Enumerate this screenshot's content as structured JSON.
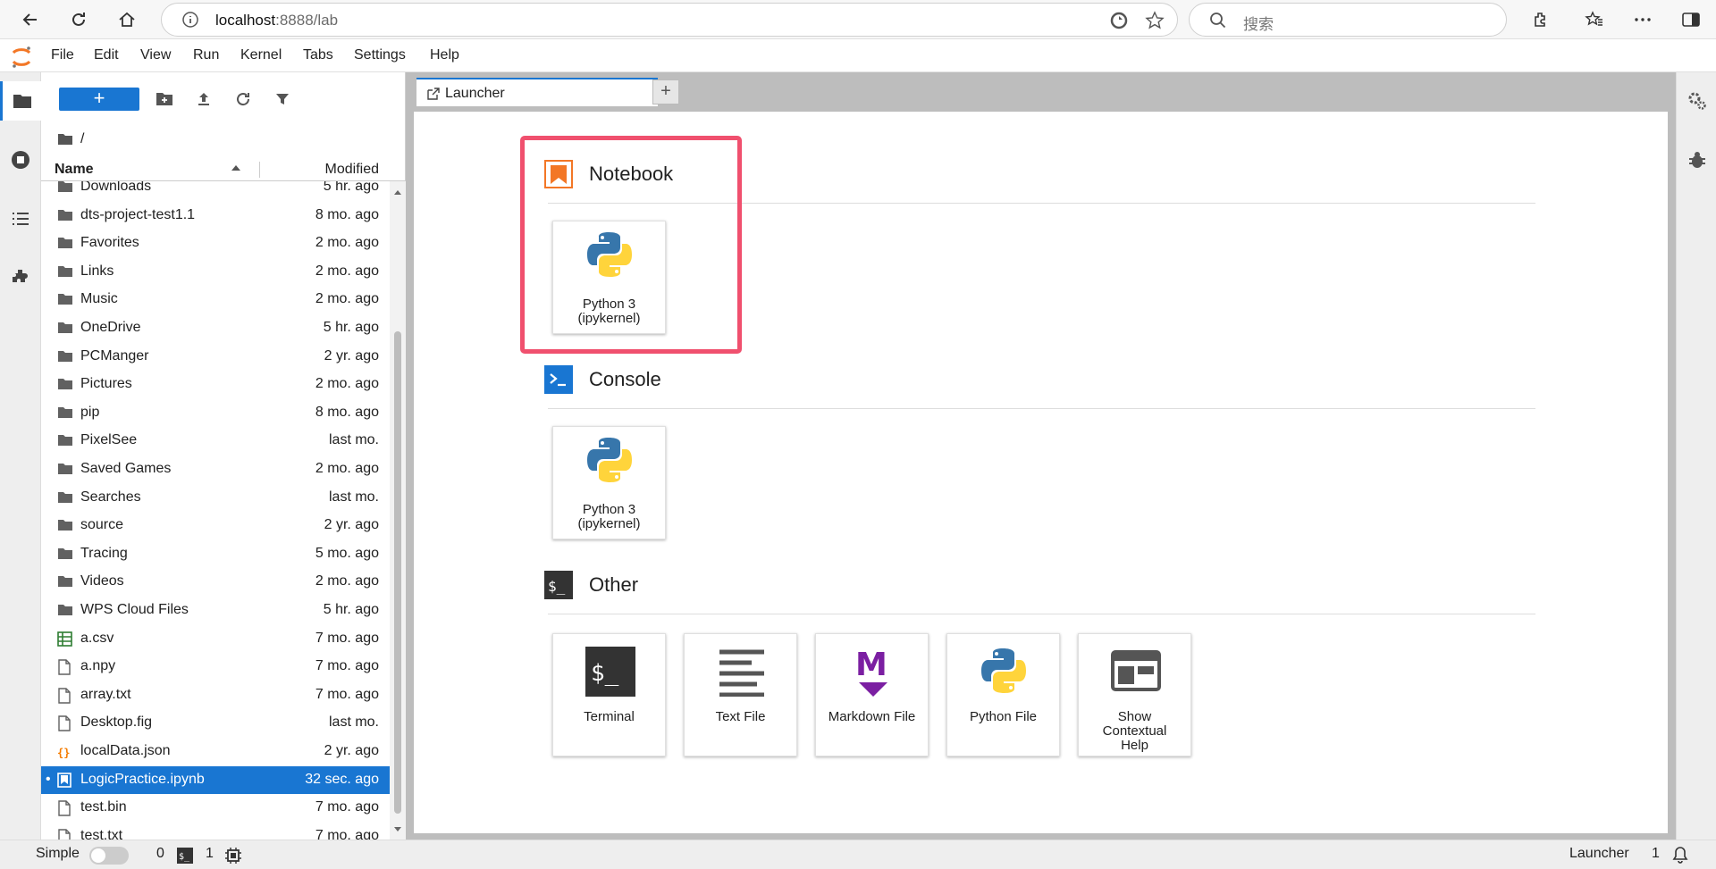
{
  "browser": {
    "url_host": "localhost",
    "url_rest": ":8888/lab",
    "search_placeholder": "搜索"
  },
  "menu": [
    "File",
    "Edit",
    "View",
    "Run",
    "Kernel",
    "Tabs",
    "Settings",
    "Help"
  ],
  "filebrowser": {
    "new_label": "+",
    "breadcrumb": "/",
    "col_name": "Name",
    "col_modified": "Modified",
    "files": [
      {
        "name": "Downloads",
        "modified": "5 hr. ago",
        "type": "folder"
      },
      {
        "name": "dts-project-test1.1",
        "modified": "8 mo. ago",
        "type": "folder"
      },
      {
        "name": "Favorites",
        "modified": "2 mo. ago",
        "type": "folder"
      },
      {
        "name": "Links",
        "modified": "2 mo. ago",
        "type": "folder"
      },
      {
        "name": "Music",
        "modified": "2 mo. ago",
        "type": "folder"
      },
      {
        "name": "OneDrive",
        "modified": "5 hr. ago",
        "type": "folder"
      },
      {
        "name": "PCManger",
        "modified": "2 yr. ago",
        "type": "folder"
      },
      {
        "name": "Pictures",
        "modified": "2 mo. ago",
        "type": "folder"
      },
      {
        "name": "pip",
        "modified": "8 mo. ago",
        "type": "folder"
      },
      {
        "name": "PixelSee",
        "modified": "last mo.",
        "type": "folder"
      },
      {
        "name": "Saved Games",
        "modified": "2 mo. ago",
        "type": "folder"
      },
      {
        "name": "Searches",
        "modified": "last mo.",
        "type": "folder"
      },
      {
        "name": "source",
        "modified": "2 yr. ago",
        "type": "folder"
      },
      {
        "name": "Tracing",
        "modified": "5 mo. ago",
        "type": "folder"
      },
      {
        "name": "Videos",
        "modified": "2 mo. ago",
        "type": "folder"
      },
      {
        "name": "WPS Cloud Files",
        "modified": "5 hr. ago",
        "type": "folder"
      },
      {
        "name": "a.csv",
        "modified": "7 mo. ago",
        "type": "csv"
      },
      {
        "name": "a.npy",
        "modified": "7 mo. ago",
        "type": "file"
      },
      {
        "name": "array.txt",
        "modified": "7 mo. ago",
        "type": "file"
      },
      {
        "name": "Desktop.fig",
        "modified": "last mo.",
        "type": "file"
      },
      {
        "name": "localData.json",
        "modified": "2 yr. ago",
        "type": "json"
      },
      {
        "name": "LogicPractice.ipynb",
        "modified": "32 sec. ago",
        "type": "notebook",
        "selected": true,
        "running": "•"
      },
      {
        "name": "test.bin",
        "modified": "7 mo. ago",
        "type": "file"
      },
      {
        "name": "test.txt",
        "modified": "7 mo. ago",
        "type": "file"
      }
    ]
  },
  "tab": {
    "label": "Launcher",
    "add": "+"
  },
  "launcher": {
    "notebook_title": "Notebook",
    "console_title": "Console",
    "other_title": "Other",
    "notebook_card": "Python 3 (ipykernel)",
    "console_card": "Python 3 (ipykernel)",
    "other_cards": [
      "Terminal",
      "Text File",
      "Markdown File",
      "Python File",
      "Show Contextual Help"
    ]
  },
  "status": {
    "mode_label": "Simple",
    "terminals": "0",
    "kernels": "1",
    "right_label": "Launcher",
    "notif_count": "1"
  },
  "colors": {
    "accent": "#1976d2",
    "highlight": "#f0506e",
    "jupyter_orange": "#f37726"
  }
}
